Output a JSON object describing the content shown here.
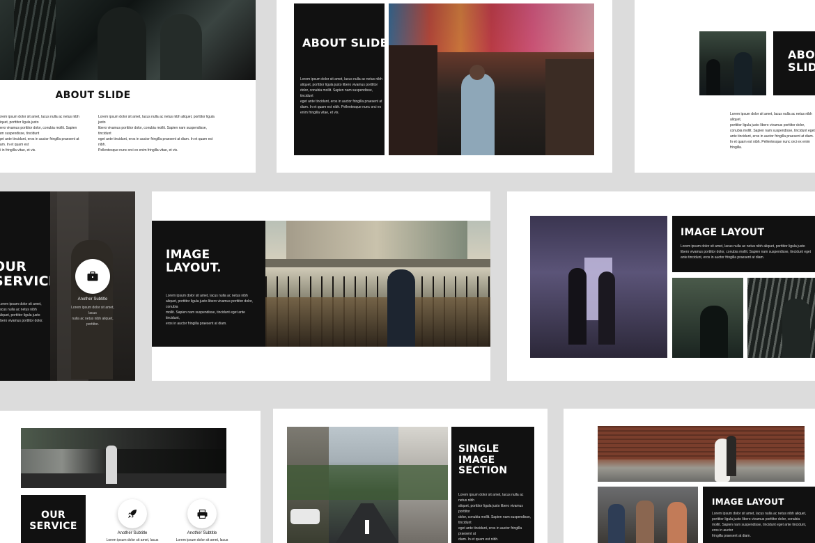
{
  "slides": {
    "about1": {
      "title": "ABOUT SLIDE",
      "col1": "Lorem ipsum dolor sit amet, lacus nulla ac netus nibh aliquet, porttitor ligula justo\nlibero vivamus porttitor dolor, conubia mollit. Sapien nam suspendisse, tincidunt\neget ante tincidunt, eros in auctor fringilla praesent at diam. In et quam est\nmi in fringilla vitae, et vis.",
      "col2": "Lorem ipsum dolor sit amet, lacus nulla ac netus nibh aliquet, porttitor ligula justo\nlibero vivamus porttitor dolor, conubia mollit. Sapien nam suspendisse, tincidunt\neget ante tincidunt, eros in auctor fringilla praesent at diam. In et quam est nibh.\nPellentesque nunc orci ex enim fringilla vitae, et vis."
    },
    "about2": {
      "title": "ABOUT SLIDE",
      "body": "Lorem ipsum dolor sit amet, lacus nulla ac netus nibh\naliquet, porttitor ligula justo libero vivamus porttitor\ndolor, conubia mollit. Sapien nam suspendisse, tincidunt\neget ante tincidunt, eros in auctor fringilla praesent at\ndiam. In et quam est nibh. Pellentesque nunc orci ex\nenim fringilla vitae, et vis."
    },
    "about3": {
      "title": "ABOUT SLIDE",
      "body": "Lorem ipsum dolor sit amet, lacus nulla ac netus nibh aliquet,\nporttitor ligula justo libero vivamus porttitor dolor,\nconubia mollit. Sapien nam suspendisse, tincidunt eget\nante tincidunt, eros in auctor fringilla praesent at diam.\nIn et quam est nibh. Pellentesque nunc orci ex enim fringilla."
    },
    "service1": {
      "title": "OUR\nSERVICE",
      "body": "Lorem ipsum dolor sit amet, lacus nulla ac netus nibh\naliquet, porttitor ligula justo\nlibero vivamus porttitor dolor.",
      "icon_subtitle": "Another Subtitle",
      "icon_text": "Lorem ipsum dolor sit amet, lacus\nnulla ac netus nibh aliquet,\nporttitor."
    },
    "image1": {
      "title": "IMAGE\nLAYOUT.",
      "body": "Lorem ipsum dolor sit amet, lacus nulla ac netus nibh\naliquet, porttitor ligula justo libero vivamus porttitor dolor, conubia\nmollit. Sapien nam suspendisse, tincidunt eget ante tincidunt,\neros in auctor fringilla praesent at diam."
    },
    "image2": {
      "title": "IMAGE LAYOUT",
      "body": "Lorem ipsum dolor sit amet, lacus nulla ac netus nibh aliquet, porttitor ligula justo\nlibero vivamus porttitor dolor, conubia mollit. Sapien nam suspendisse, tincidunt eget\nante tincidunt, eros in auctor fringilla praesent at diam."
    },
    "service2": {
      "title": "OUR\nSERVICE",
      "sub1": "Another Subtitle",
      "sub2": "Another Subtitle",
      "txt1": "Lorem ipsum dolor sit amet, lacus",
      "txt2": "Lorem ipsum dolor sit amet, lacus"
    },
    "single": {
      "title": "SINGLE\nIMAGE\nSECTION",
      "body": "Lorem ipsum dolor sit amet, lacus nulla ac netus nibh\naliquet, porttitor ligula justo libero vivamus porttitor\ndolor, conubia mollit. Sapien nam suspendisse, tincidunt\neget ante tincidunt, eros in auctor fringilla praesent at\ndiam. In et quam est nibh."
    },
    "image3": {
      "title": "IMAGE LAYOUT",
      "body": "Lorem ipsum dolor sit amet, lacus nulla ac netus nibh aliquet,\nporttitor ligula justo libero vivamus porttitor dolor, conubia\nmollit. Sapien nam suspendisse, tincidunt eget ante tincidunt, eros in auctor\nfringilla praesent at diam."
    }
  },
  "icons": {
    "briefcase": "briefcase-icon",
    "rocket": "rocket-icon",
    "printer": "printer-icon"
  },
  "colors": {
    "background": "#dcdcdc",
    "slide": "#ffffff",
    "panel": "#111111"
  }
}
